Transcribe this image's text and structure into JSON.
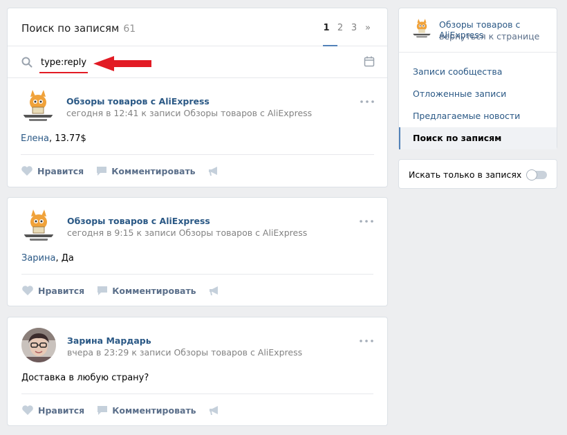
{
  "search": {
    "title": "Поиск по записям",
    "count": "61",
    "pages": [
      "1",
      "2",
      "3",
      "»"
    ],
    "query": "type:reply"
  },
  "posts": [
    {
      "author": "Обзоры товаров с AliExpress",
      "meta": "сегодня в 12:41 к записи Обзоры товаров с AliExpress",
      "text_name": "Елена",
      "text_rest": ", 13.77$",
      "avatar": "cat-logo"
    },
    {
      "author": "Обзоры товаров с AliExpress",
      "meta": "сегодня в 9:15 к записи Обзоры товаров с AliExpress",
      "text_name": "Зарина",
      "text_rest": ", Да",
      "avatar": "cat-logo"
    },
    {
      "author": "Зарина Мардарь",
      "meta": "вчера в 23:29 к записи Обзоры товаров с AliExpress",
      "text_name": "",
      "text_rest": "Доставка в любую страну?",
      "avatar": "user-photo"
    }
  ],
  "actions": {
    "like": "Нравится",
    "comment": "Комментировать"
  },
  "sidebar": {
    "group_name": "Обзоры товаров с AliExpress",
    "back": "вернуться к странице",
    "items": [
      "Записи сообщества",
      "Отложенные записи",
      "Предлагаемые новости",
      "Поиск по записям"
    ],
    "active_index": 3
  },
  "toggle": {
    "label": "Искать только в записях",
    "on": false
  },
  "colors": {
    "link": "#2a5885",
    "accent": "#5181b8",
    "highlight": "#e21b24",
    "background": "#edeef0"
  }
}
